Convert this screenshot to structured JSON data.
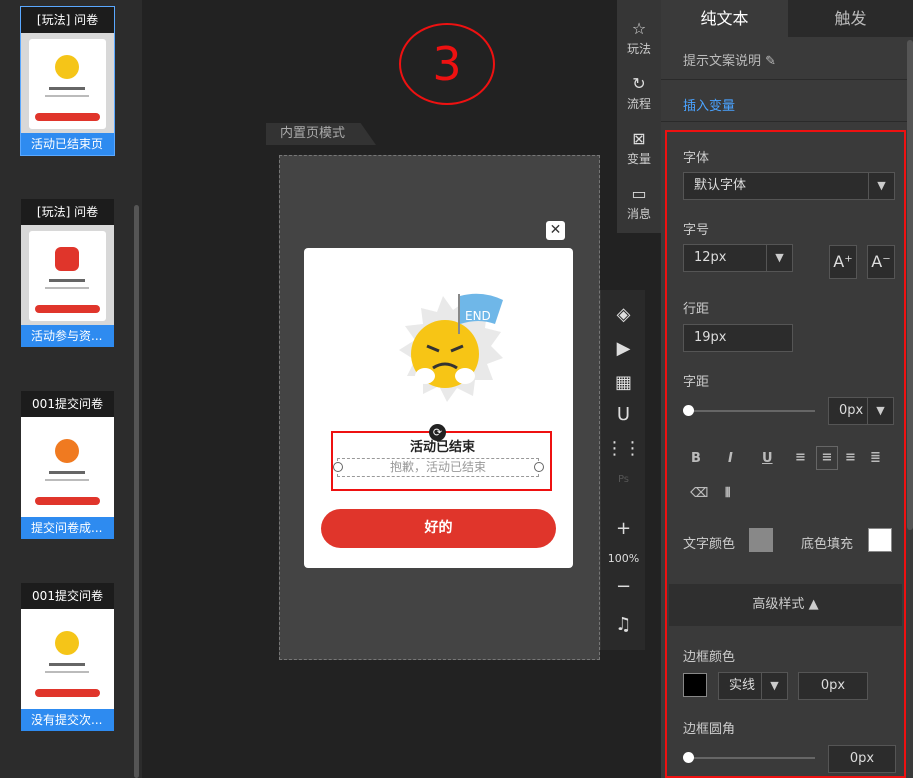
{
  "thumbnails": [
    {
      "title": "[玩法] 问卷",
      "caption": "活动已结束页"
    },
    {
      "title": "[玩法] 问卷",
      "caption": "活动参与资..."
    },
    {
      "title": "001提交问卷",
      "caption": "提交问卷成..."
    },
    {
      "title": "001提交问卷",
      "caption": "没有提交次..."
    }
  ],
  "canvas": {
    "step_marker": "3",
    "mode_tab": "内置页模式",
    "close_glyph": "✕",
    "popup_title": "活动已结束",
    "popup_subtitle": "抱歉，活动已结束",
    "ok_button": "好的",
    "flag_label": "END"
  },
  "vmenu": [
    {
      "label": "玩法",
      "icon": "play-rules-icon"
    },
    {
      "label": "流程",
      "icon": "flow-icon"
    },
    {
      "label": "变量",
      "icon": "variable-icon"
    },
    {
      "label": "消息",
      "icon": "message-icon"
    }
  ],
  "tools": {
    "zoom": "100%",
    "plus": "+",
    "minus": "−"
  },
  "panel": {
    "tab_text": "纯文本",
    "tab_trigger": "触发",
    "hint": "提示文案说明",
    "insert_var": "插入变量",
    "font_label": "字体",
    "font_value": "默认字体",
    "size_label": "字号",
    "size_value": "12px",
    "line_label": "行距",
    "line_value": "19px",
    "spacing_label": "字距",
    "spacing_value": "0px",
    "bold": "B",
    "italic": "I",
    "underline": "U",
    "text_color_label": "文字颜色",
    "bg_fill_label": "底色填充",
    "advanced": "高级样式",
    "border_color_label": "边框颜色",
    "border_style": "实线",
    "border_width": "0px",
    "radius_label": "边框圆角",
    "radius_value": "0px"
  },
  "colors": {
    "accent_red": "#e0352b",
    "link_blue": "#4aa3ff",
    "caption_blue": "#2e8bf0",
    "highlight_red": "#ee1111"
  }
}
